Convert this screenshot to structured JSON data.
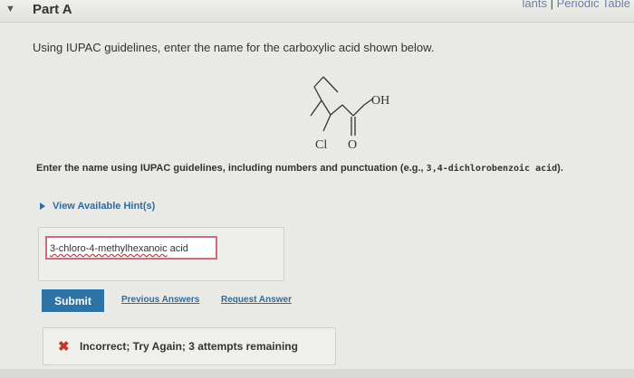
{
  "header": {
    "part_title": "Part A",
    "top_links_partial": "lants",
    "separator": " | ",
    "periodic_table": "Periodic Table"
  },
  "question": {
    "prompt": "Using IUPAC guidelines, enter the name for the carboxylic acid shown below.",
    "structure_labels": {
      "oh": "OH",
      "cl": "Cl",
      "o": "O"
    }
  },
  "instructions": {
    "text": "Enter the name using IUPAC guidelines, including numbers and punctuation (e.g.,",
    "example": "3,4-dichlorobenzoic acid",
    "closing": ")."
  },
  "hints": {
    "label": "View Available Hint(s)"
  },
  "answer": {
    "value_error": "3-chloro-4-methylhexanoic",
    "value_rest": " acid"
  },
  "actions": {
    "submit_label": "Submit",
    "previous_answers_label": "Previous Answers",
    "request_answer_label": "Request Answer"
  },
  "feedback": {
    "icon": "x-icon",
    "message": "Incorrect; Try Again; 3 attempts remaining",
    "color": "#c0392b"
  },
  "colors": {
    "link": "#2d6ca2",
    "submit_bg": "#2d73a5",
    "answer_border": "#d06a7c"
  }
}
